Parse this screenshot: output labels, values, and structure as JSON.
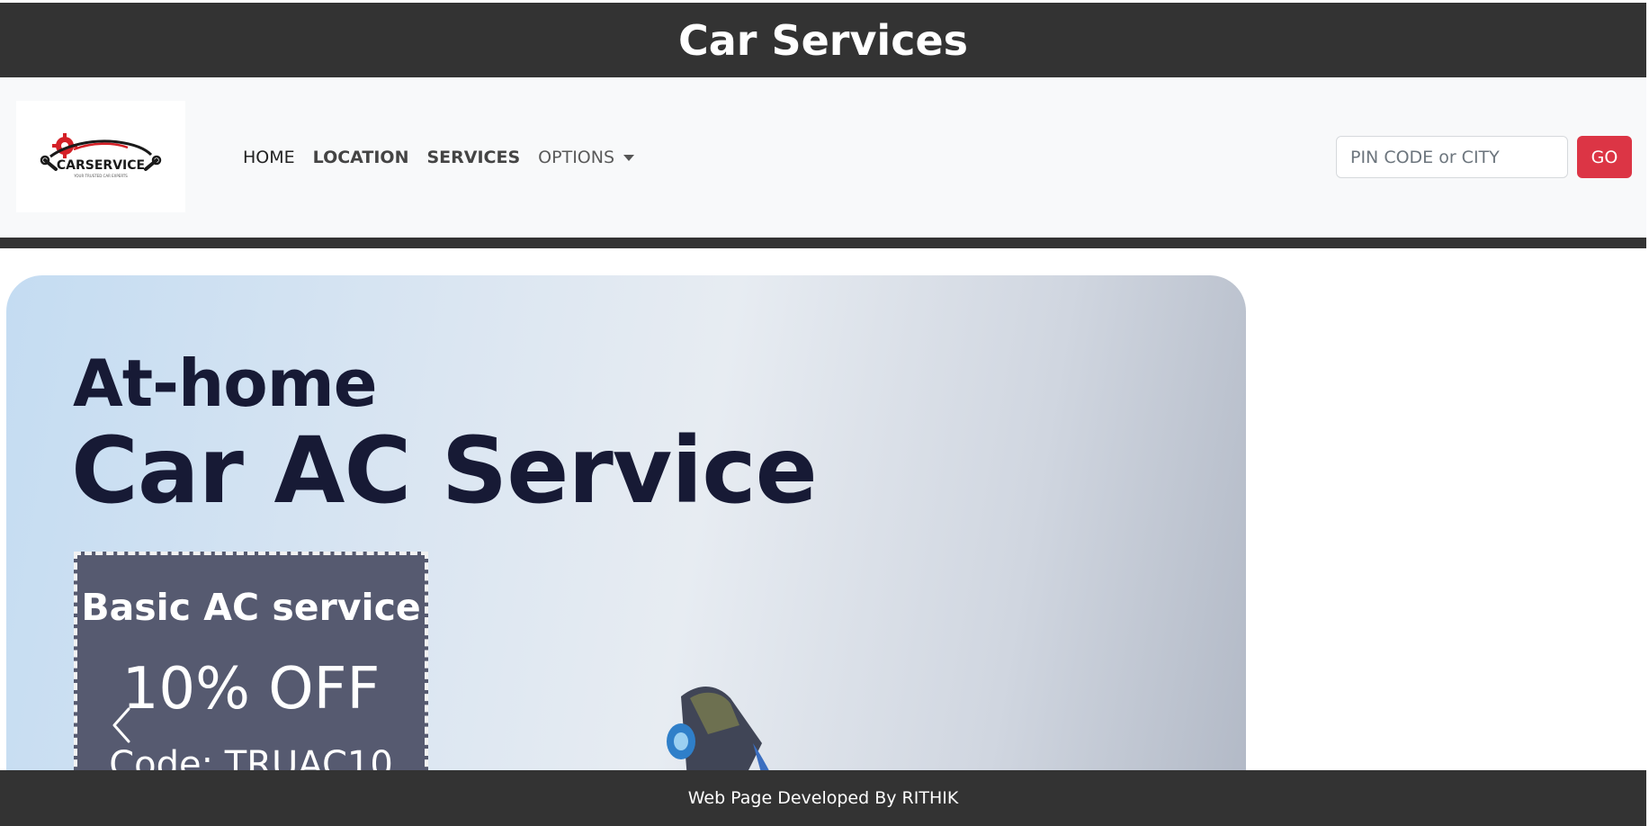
{
  "header": {
    "title": "Car Services"
  },
  "navbar": {
    "logo": {
      "brand_text": "CARSERVICE",
      "tagline": "YOUR TRUSTED CAR EXPERTS"
    },
    "links": [
      {
        "label": "HOME"
      },
      {
        "label": "LOCATION"
      },
      {
        "label": "SERVICES"
      },
      {
        "label": "OPTIONS"
      }
    ],
    "search": {
      "placeholder": "PIN CODE or CITY",
      "value": ""
    },
    "go_label": "GO"
  },
  "carousel": {
    "slide": {
      "line1": "At-home",
      "line2": "Car AC Service",
      "offer_title": "Basic AC service",
      "offer_discount": "10% OFF",
      "offer_code": "Code: TRUAC10"
    }
  },
  "footer": {
    "text": "Web Page Developed By RITHIK"
  },
  "colors": {
    "dark_bar": "#333333",
    "navbar_bg": "#f8f9fa",
    "go_button": "#dc3545",
    "headline": "#171a35",
    "offer_box": "#565a70"
  }
}
